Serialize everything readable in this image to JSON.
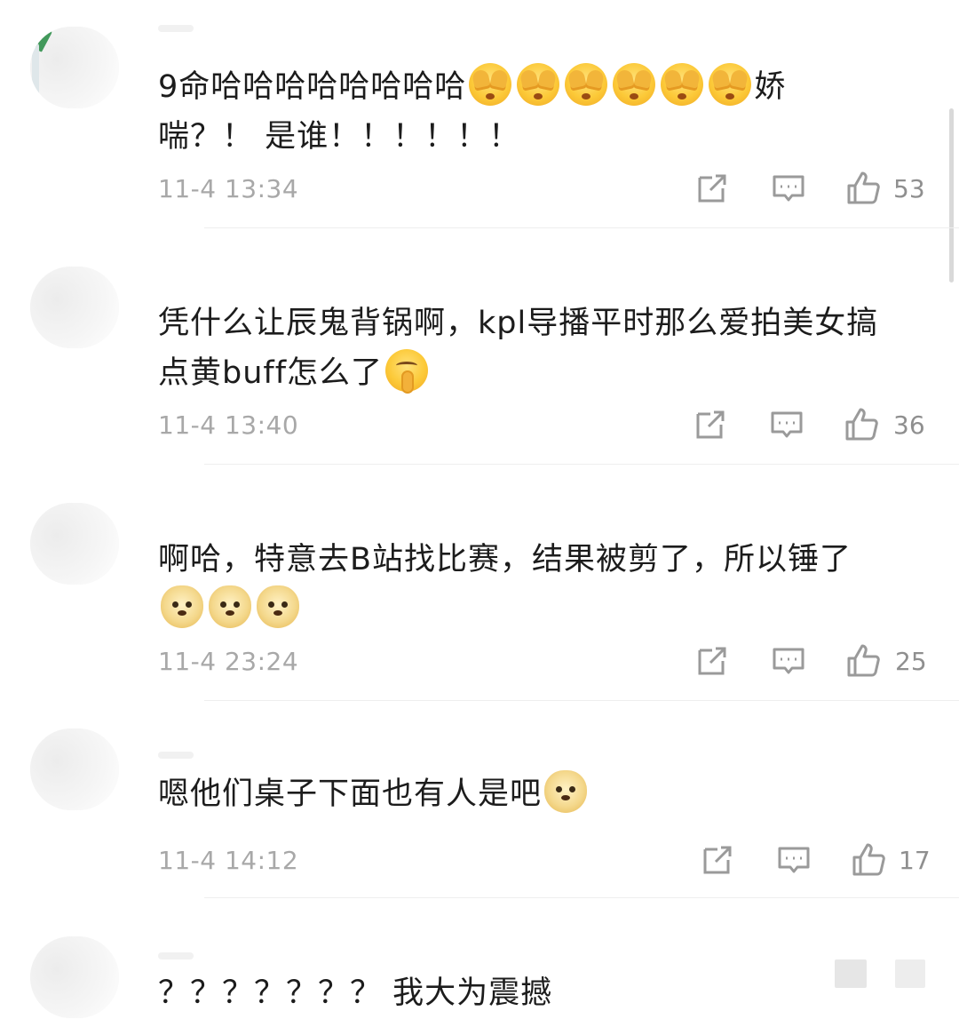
{
  "comments": [
    {
      "text_a": "9命哈哈哈哈哈哈哈哈",
      "emojis_a": [
        "cover-face-icon",
        "cover-face-icon",
        "cover-face-icon",
        "cover-face-icon",
        "cover-face-icon",
        "cover-face-icon"
      ],
      "text_b": "娇",
      "line2": "喘？！ 是谁！！！！！！",
      "time": "11-4 13:34",
      "likes": "53"
    },
    {
      "text_a": "凭什么让辰鬼背锅啊，kpl导播平时那么爱拍美女搞",
      "line2": "点黄buff怎么了",
      "emojis_b": [
        "shh-face-icon"
      ],
      "time": "11-4 13:40",
      "likes": "36"
    },
    {
      "text_a": "啊哈，特意去B站找比赛，结果被剪了，所以锤了",
      "emojis_b": [
        "doge-icon",
        "doge-icon",
        "doge-icon"
      ],
      "time": "11-4 23:24",
      "likes": "25"
    },
    {
      "text_a": "嗯他们桌子下面也有人是吧",
      "emojis_a": [
        "doge-icon"
      ],
      "time": "11-4 14:12",
      "likes": "17"
    },
    {
      "text_a": "？？？？？？？ 我大为震撼"
    }
  ],
  "icons": {
    "share": "share-icon",
    "reply": "comment-icon",
    "like": "thumbs-up-icon"
  },
  "colors": {
    "text": "#1c1c1c",
    "meta": "#a8a8a8",
    "icon": "#9a9a9a",
    "divider": "#eeeeee"
  }
}
